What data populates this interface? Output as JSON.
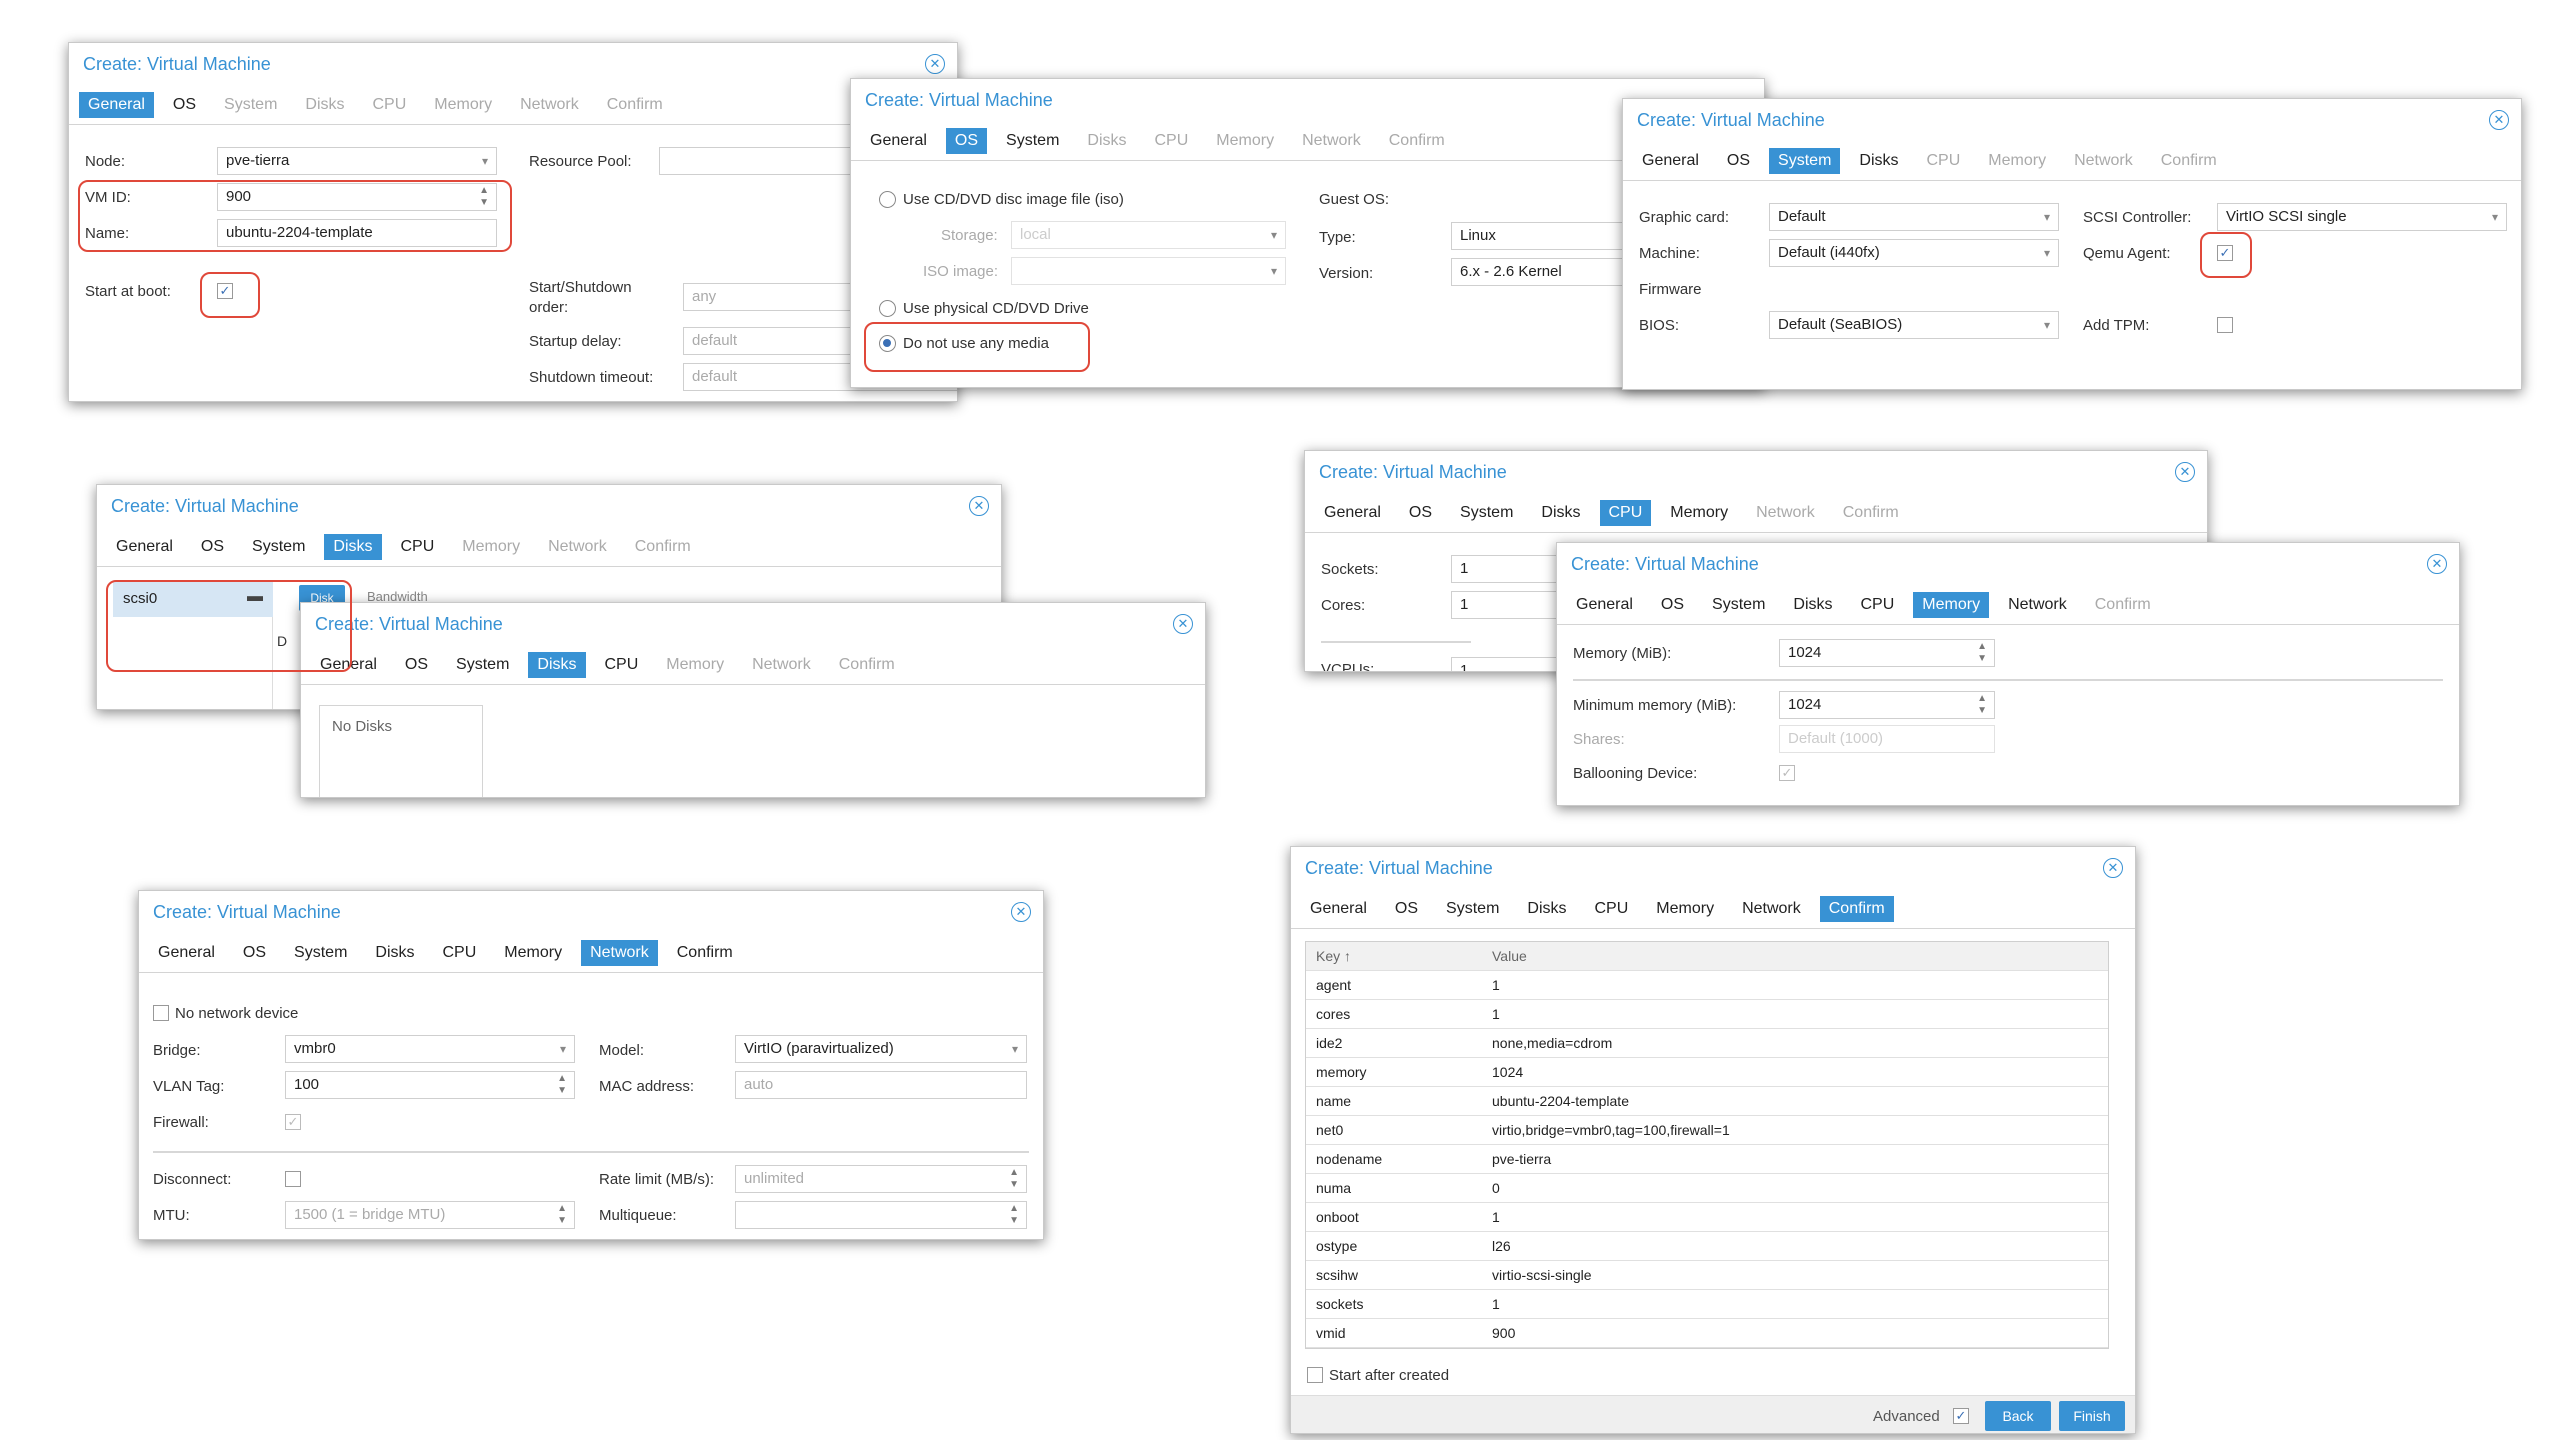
{
  "dialog_title": "Create: Virtual Machine",
  "tabs": [
    "General",
    "OS",
    "System",
    "Disks",
    "CPU",
    "Memory",
    "Network",
    "Confirm"
  ],
  "general": {
    "node_label": "Node:",
    "node_value": "pve-tierra",
    "resource_pool_label": "Resource Pool:",
    "vmid_label": "VM ID:",
    "vmid_value": "900",
    "name_label": "Name:",
    "name_value": "ubuntu-2204-template",
    "start_at_boot_label": "Start at boot:",
    "start_shutdown_label_1": "Start/Shutdown",
    "start_shutdown_label_2": "order:",
    "start_shutdown_value": "any",
    "startup_delay_label": "Startup delay:",
    "startup_delay_value": "default",
    "shutdown_timeout_label": "Shutdown timeout:",
    "shutdown_timeout_value": "default"
  },
  "os": {
    "use_iso_label": "Use CD/DVD disc image file (iso)",
    "storage_label": "Storage:",
    "storage_value": "local",
    "iso_image_label": "ISO image:",
    "use_physical_label": "Use physical CD/DVD Drive",
    "no_media_label": "Do not use any media",
    "guest_os_label": "Guest OS:",
    "type_label": "Type:",
    "type_value": "Linux",
    "version_label": "Version:",
    "version_value": "6.x - 2.6 Kernel"
  },
  "system": {
    "graphic_card_label": "Graphic card:",
    "graphic_card_value": "Default",
    "machine_label": "Machine:",
    "machine_value": "Default (i440fx)",
    "firmware_label": "Firmware",
    "bios_label": "BIOS:",
    "bios_value": "Default (SeaBIOS)",
    "scsi_controller_label": "SCSI Controller:",
    "scsi_controller_value": "VirtIO SCSI single",
    "qemu_agent_label": "Qemu Agent:",
    "add_tpm_label": "Add TPM:"
  },
  "disks": {
    "disk_item": "scsi0",
    "peek_button": "Disk",
    "peek_text": "Bandwidth",
    "peek_letter": "D",
    "no_disks_label": "No Disks"
  },
  "cpu": {
    "sockets_label": "Sockets:",
    "sockets_value": "1",
    "cores_label": "Cores:",
    "cores_value": "1",
    "vcpus_label": "VCPUs:",
    "vcpus_value": "1"
  },
  "memory": {
    "memory_label": "Memory (MiB):",
    "memory_value": "1024",
    "min_memory_label": "Minimum memory (MiB):",
    "min_memory_value": "1024",
    "shares_label": "Shares:",
    "shares_value": "Default (1000)",
    "ballooning_label": "Ballooning Device:"
  },
  "network": {
    "no_network_label": "No network device",
    "bridge_label": "Bridge:",
    "bridge_value": "vmbr0",
    "vlan_label": "VLAN Tag:",
    "vlan_value": "100",
    "firewall_label": "Firewall:",
    "model_label": "Model:",
    "model_value": "VirtIO (paravirtualized)",
    "mac_label": "MAC address:",
    "mac_value": "auto",
    "disconnect_label": "Disconnect:",
    "mtu_label": "MTU:",
    "mtu_value": "1500 (1 = bridge MTU)",
    "rate_label": "Rate limit (MB/s):",
    "rate_value": "unlimited",
    "multiqueue_label": "Multiqueue:"
  },
  "confirm": {
    "col_key": "Key ↑",
    "col_value": "Value",
    "rows": [
      {
        "key": "agent",
        "value": "1"
      },
      {
        "key": "cores",
        "value": "1"
      },
      {
        "key": "ide2",
        "value": "none,media=cdrom"
      },
      {
        "key": "memory",
        "value": "1024"
      },
      {
        "key": "name",
        "value": "ubuntu-2204-template"
      },
      {
        "key": "net0",
        "value": "virtio,bridge=vmbr0,tag=100,firewall=1"
      },
      {
        "key": "nodename",
        "value": "pve-tierra"
      },
      {
        "key": "numa",
        "value": "0"
      },
      {
        "key": "onboot",
        "value": "1"
      },
      {
        "key": "ostype",
        "value": "l26"
      },
      {
        "key": "scsihw",
        "value": "virtio-scsi-single"
      },
      {
        "key": "sockets",
        "value": "1"
      },
      {
        "key": "vmid",
        "value": "900"
      }
    ],
    "start_after_label": "Start after created",
    "advanced_label": "Advanced",
    "back_label": "Back",
    "finish_label": "Finish"
  },
  "colors": {
    "accent": "#3892d4",
    "highlight": "#e0483a"
  }
}
